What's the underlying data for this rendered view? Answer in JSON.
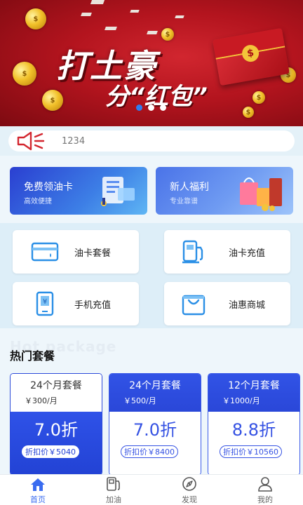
{
  "banner": {
    "title": "打土豪",
    "subtitle": "分“红包”",
    "carousel_total": 3,
    "carousel_active_index": 0
  },
  "notice": {
    "icon": "speaker-icon",
    "text": "1234"
  },
  "promos": [
    {
      "title": "免费领油卡",
      "subtitle": "高效便捷"
    },
    {
      "title": "新人福利",
      "subtitle": "专业靠谱"
    }
  ],
  "services": [
    {
      "label": "油卡套餐",
      "icon": "card-icon"
    },
    {
      "label": "油卡充值",
      "icon": "fuel-pump-icon"
    },
    {
      "label": "手机充值",
      "icon": "phone-recharge-icon"
    },
    {
      "label": "油惠商城",
      "icon": "shopping-bag-icon"
    }
  ],
  "hot": {
    "watermark": "Hot package",
    "title": "热门套餐",
    "packages": [
      {
        "name": "24个月套餐",
        "price": "￥300/月",
        "discount": "7.0折",
        "final": "折扣价￥5040",
        "selected": true
      },
      {
        "name": "24个月套餐",
        "price": "￥500/月",
        "discount": "7.0折",
        "final": "折扣价￥8400",
        "selected": false
      },
      {
        "name": "12个月套餐",
        "price": "￥1000/月",
        "discount": "8.8折",
        "final": "折扣价￥10560",
        "selected": false
      }
    ]
  },
  "tabbar": {
    "items": [
      {
        "label": "首页",
        "icon": "home-icon",
        "active": true
      },
      {
        "label": "加油",
        "icon": "fuel-pump-icon",
        "active": false
      },
      {
        "label": "发现",
        "icon": "compass-icon",
        "active": false
      },
      {
        "label": "我的",
        "icon": "user-icon",
        "active": false
      }
    ]
  },
  "colors": {
    "accent": "#3a6cf0",
    "package_blue": "#2f52e8",
    "banner_red": "#b3141e"
  }
}
